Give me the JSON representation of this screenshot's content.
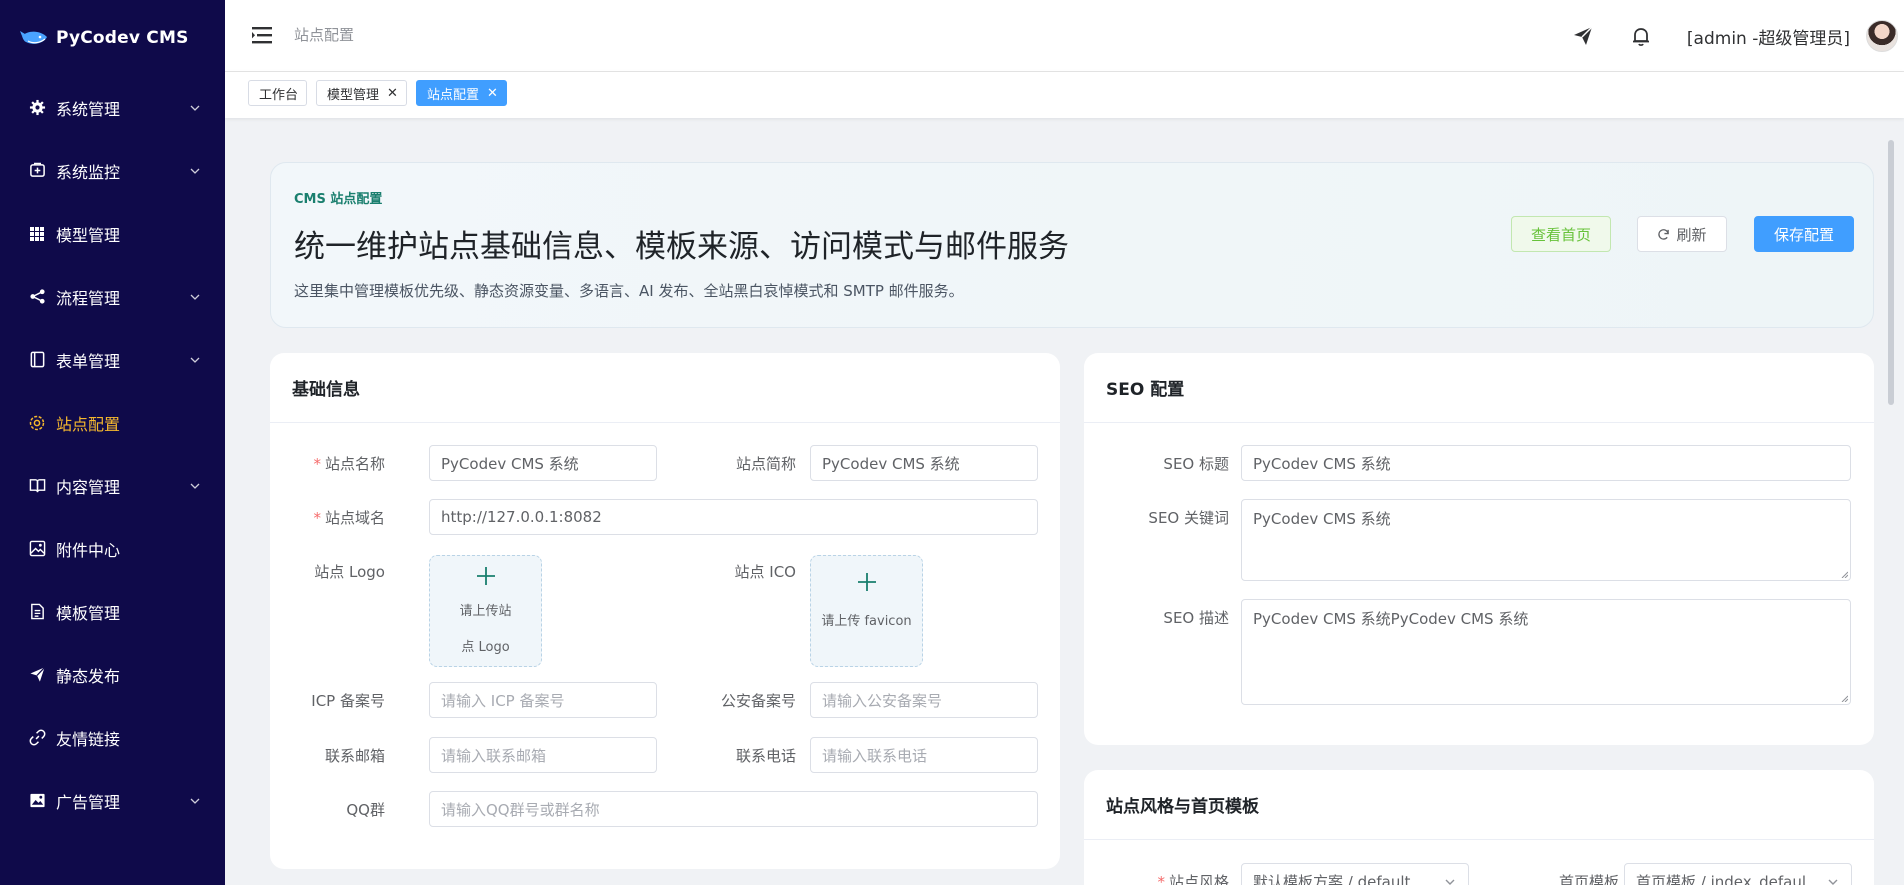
{
  "app": {
    "name": "PyCodev CMS"
  },
  "sidebar": {
    "items": [
      {
        "label": "系统管理",
        "icon": "gear-icon",
        "has_children": true
      },
      {
        "label": "系统监控",
        "icon": "monitor-icon",
        "has_children": true
      },
      {
        "label": "模型管理",
        "icon": "grid-icon",
        "has_children": false
      },
      {
        "label": "流程管理",
        "icon": "share-icon",
        "has_children": true
      },
      {
        "label": "表单管理",
        "icon": "form-icon",
        "has_children": true
      },
      {
        "label": "站点配置",
        "icon": "settings-icon",
        "has_children": false,
        "active": true
      },
      {
        "label": "内容管理",
        "icon": "book-icon",
        "has_children": true
      },
      {
        "label": "附件中心",
        "icon": "image-icon",
        "has_children": false
      },
      {
        "label": "模板管理",
        "icon": "document-icon",
        "has_children": false
      },
      {
        "label": "静态发布",
        "icon": "send-icon",
        "has_children": false
      },
      {
        "label": "友情链接",
        "icon": "link-icon",
        "has_children": false
      },
      {
        "label": "广告管理",
        "icon": "picture-icon",
        "has_children": true
      }
    ]
  },
  "header": {
    "breadcrumb": "站点配置",
    "user": "[admin -超级管理员]"
  },
  "tabs": [
    {
      "label": "工作台",
      "closable": false,
      "active": false
    },
    {
      "label": "模型管理",
      "closable": true,
      "active": false
    },
    {
      "label": "站点配置",
      "closable": true,
      "active": true
    }
  ],
  "hero": {
    "kicker": "CMS 站点配置",
    "title": "统一维护站点基础信息、模板来源、访问模式与邮件服务",
    "description": "这里集中管理模板优先级、静态资源变量、多语言、AI 发布、全站黑白哀悼模式和 SMTP 邮件服务。",
    "btn_view": "查看首页",
    "btn_refresh": "刷新",
    "btn_save": "保存配置"
  },
  "basic": {
    "title": "基础信息",
    "site_name_label": "站点名称",
    "site_name_value": "PyCodev CMS 系统",
    "short_name_label": "站点简称",
    "short_name_value": "PyCodev CMS 系统",
    "domain_label": "站点域名",
    "domain_value": "http://127.0.0.1:8082",
    "logo_label": "站点 Logo",
    "logo_hint": "请上传站点 Logo",
    "ico_label": "站点 ICO",
    "ico_hint": "请上传 favicon",
    "icp_label": "ICP 备案号",
    "icp_placeholder": "请输入 ICP 备案号",
    "police_label": "公安备案号",
    "police_placeholder": "请输入公安备案号",
    "email_label": "联系邮箱",
    "email_placeholder": "请输入联系邮箱",
    "phone_label": "联系电话",
    "phone_placeholder": "请输入联系电话",
    "qq_label": "QQ群",
    "qq_placeholder": "请输入QQ群号或群名称"
  },
  "seo": {
    "title": "SEO 配置",
    "seo_title_label": "SEO 标题",
    "seo_title_value": "PyCodev CMS 系统",
    "keywords_label": "SEO 关键词",
    "keywords_value": "PyCodev CMS 系统",
    "desc_label": "SEO 描述",
    "desc_value": "PyCodev CMS 系统PyCodev CMS 系统"
  },
  "style": {
    "title": "站点风格与首页模板",
    "style_label": "站点风格",
    "style_value": "默认模板方案 / default",
    "home_label": "首页模板",
    "home_value": "首页模板 / index_defaul"
  },
  "colors": {
    "sidebar_bg": "#0f0a4a",
    "active_menu": "#f5b82e",
    "primary": "#409eff"
  }
}
